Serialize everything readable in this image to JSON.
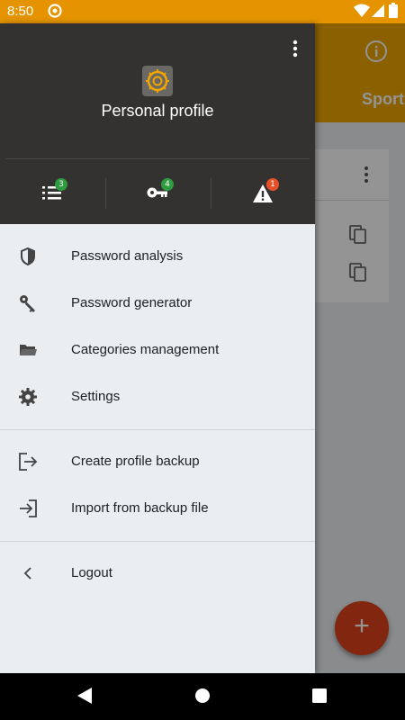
{
  "status_bar": {
    "time": "8:50"
  },
  "background": {
    "visible_tab_label": "Sport",
    "fab_label": "+"
  },
  "drawer": {
    "profile_name": "Personal profile",
    "stats": [
      {
        "icon": "list-icon",
        "badge": "3",
        "badge_color": "#2E9B3E"
      },
      {
        "icon": "key-icon",
        "badge": "4",
        "badge_color": "#2E9B3E"
      },
      {
        "icon": "warning-icon",
        "badge": "1",
        "badge_color": "#E8502A"
      }
    ],
    "menu_groups": [
      [
        {
          "icon": "shield-icon",
          "label": "Password analysis"
        },
        {
          "icon": "key-icon",
          "label": "Password generator"
        },
        {
          "icon": "folder-icon",
          "label": "Categories management"
        },
        {
          "icon": "gear-icon",
          "label": "Settings"
        }
      ],
      [
        {
          "icon": "export-icon",
          "label": "Create profile backup"
        },
        {
          "icon": "import-icon",
          "label": "Import from backup file"
        }
      ],
      [
        {
          "icon": "chevron-left-icon",
          "label": "Logout"
        }
      ]
    ]
  },
  "colors": {
    "accent": "#F0A500",
    "status_bar": "#E59400",
    "header": "#333230",
    "fab": "#E0421C"
  }
}
